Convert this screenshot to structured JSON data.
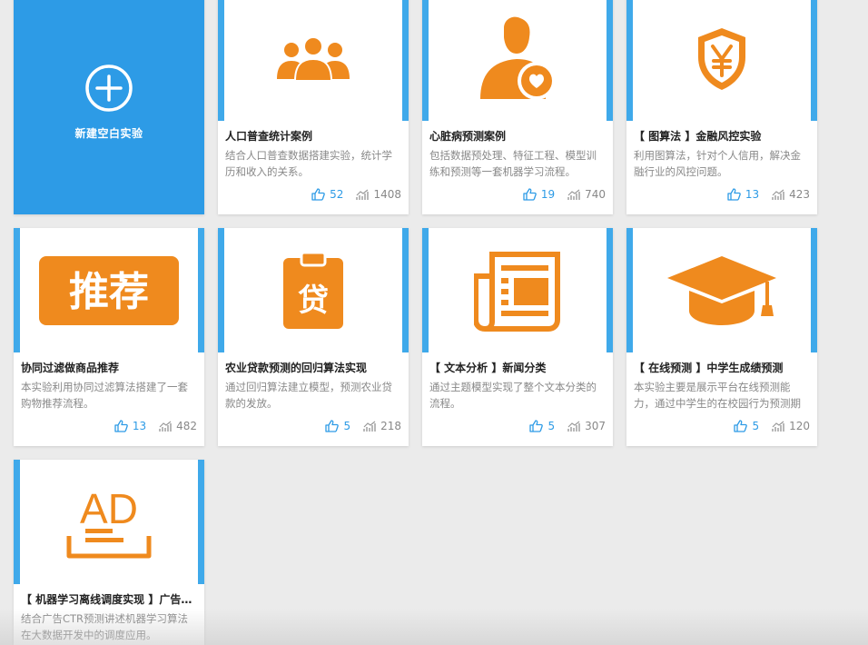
{
  "new_experiment": {
    "label": "新建空白实验"
  },
  "cards": [
    {
      "title": "人口普查统计案例",
      "desc": "结合人口普查数据搭建实验，统计学历和收入的关系。",
      "likes": "52",
      "views": "1408",
      "icon": "people-group-icon"
    },
    {
      "title": "心脏病预测案例",
      "desc": "包括数据预处理、特征工程、模型训练和预测等一套机器学习流程。",
      "likes": "19",
      "views": "740",
      "icon": "doctor-heart-icon"
    },
    {
      "title": "【 图算法 】金融风控实验",
      "desc": "利用图算法，针对个人信用，解决金融行业的风控问题。",
      "likes": "13",
      "views": "423",
      "icon": "yen-shield-icon"
    },
    {
      "title": "协同过滤做商品推荐",
      "desc": "本实验利用协同过滤算法搭建了一套购物推荐流程。",
      "likes": "13",
      "views": "482",
      "icon": "recommend-icon",
      "icon_text": "推荐"
    },
    {
      "title": "农业贷款预测的回归算法实现",
      "desc": "通过回归算法建立模型，预测农业贷款的发放。",
      "likes": "5",
      "views": "218",
      "icon": "loan-clipboard-icon",
      "icon_text": "贷"
    },
    {
      "title": "【 文本分析 】新闻分类",
      "desc": "通过主题模型实现了整个文本分类的流程。",
      "likes": "5",
      "views": "307",
      "icon": "newspaper-icon"
    },
    {
      "title": "【 在线预测 】中学生成绩预测",
      "desc": "本实验主要是展示平台在线预测能力，通过中学生的在校园行为预测期末成绩。",
      "likes": "5",
      "views": "120",
      "icon": "graduation-cap-icon"
    },
    {
      "title": "【 机器学习离线调度实现 】广告CTR预测",
      "desc": "结合广告CTR预测讲述机器学习算法在大数据开发中的调度应用。",
      "likes": "",
      "views": "",
      "icon": "ad-icon",
      "icon_text": "AD"
    }
  ],
  "colors": {
    "accent": "#2d9be6",
    "icon_orange": "#ef8a1e",
    "frame_blue": "#3fa9ea"
  }
}
